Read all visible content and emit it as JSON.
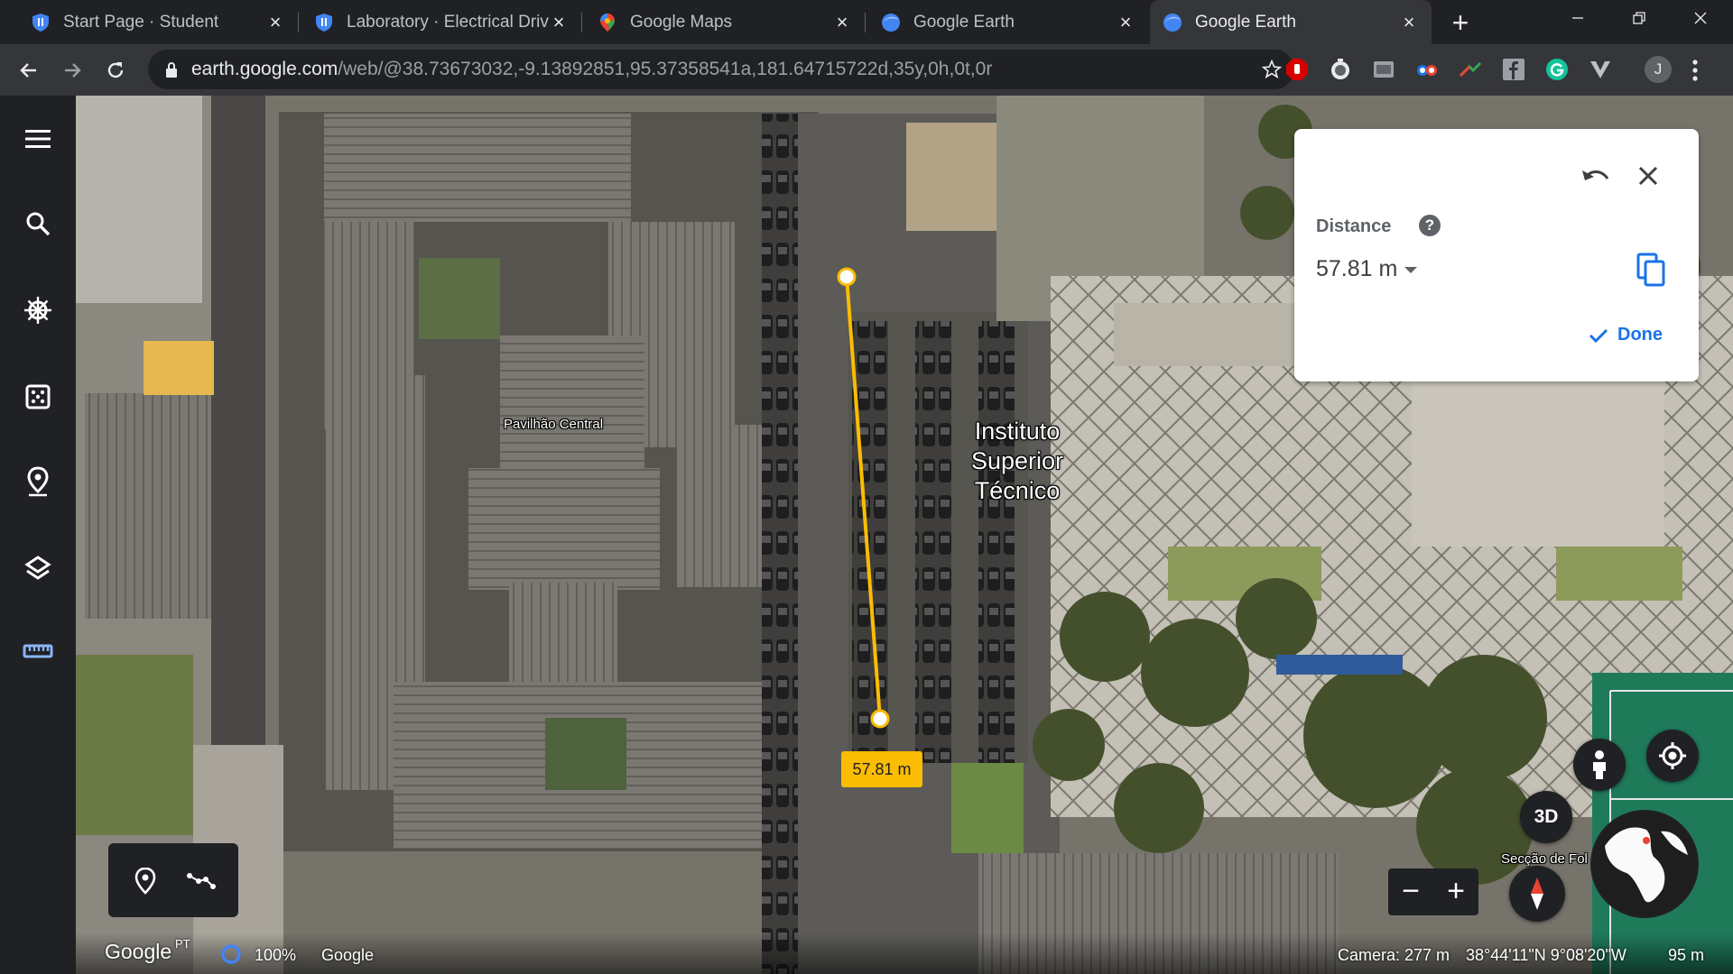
{
  "browser": {
    "tabs": [
      {
        "title": "Start Page · Student",
        "favicon": "shield-icon"
      },
      {
        "title": "Laboratory · Electrical Drive",
        "favicon": "shield-icon"
      },
      {
        "title": "Google Maps",
        "favicon": "maps-pin-icon"
      },
      {
        "title": "Google Earth",
        "favicon": "earth-globe-icon"
      },
      {
        "title": "Google Earth",
        "favicon": "earth-globe-icon",
        "active": true
      }
    ],
    "address": {
      "domain": "earth.google.com",
      "path": "/web/@38.73673032,-9.13892851,95.37358541a,181.64715722d,35y,0h,0t,0r"
    },
    "profile_initial": "J"
  },
  "measure_panel": {
    "label": "Distance",
    "help": "?",
    "value": "57.81 m",
    "done": "Done"
  },
  "map": {
    "labels": {
      "building": "Pavilhão Central",
      "campus": [
        "Instituto",
        "Superior",
        "Técnico"
      ],
      "place_partial": "Secção de Fol"
    },
    "distance_badge": "57.81 m",
    "view_3d": "3D",
    "zoom_out": "−",
    "zoom_in": "+",
    "footer": {
      "logo": "Google",
      "logo_suffix": "PT",
      "load_percent": "100%",
      "attribution": "Google",
      "camera": "Camera: 277 m",
      "coords": "38°44'11\"N 9°08'20\"W",
      "scale": "95 m"
    }
  },
  "colors": {
    "measure_line": "#fbbc04",
    "accent": "#1a73e8",
    "rail_active": "#8ab4f8"
  }
}
